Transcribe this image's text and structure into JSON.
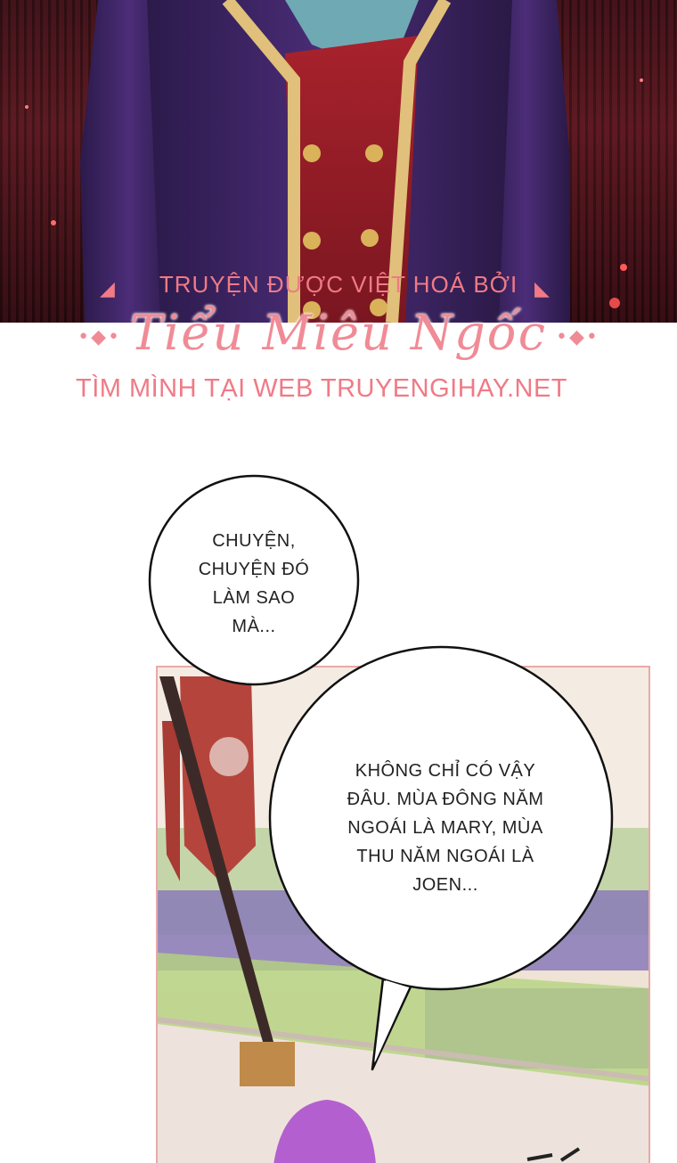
{
  "credits": {
    "line1": "TRUYỆN ĐƯỢC VIỆT HOÁ BỞI",
    "group_name": "Tiểu Miêu Ngốc",
    "line3": "TÌM MÌNH TẠI WEB TRUYENGIHAY.NET",
    "accent_color": "#f07a86"
  },
  "bubbles": [
    {
      "text": "CHUYỆN,\nCHUYỆN ĐÓ\nLÀM SAO\nMÀ..."
    },
    {
      "text": "KHÔNG CHỈ CÓ VẬY\nĐÂU. MÙA ĐÔNG NĂM\nNGOÁI LÀ MARY, MÙA\nTHU NĂM NGOÁI LÀ\nJOEN..."
    }
  ],
  "icons": {
    "deco_left": "ornament-left-icon",
    "deco_right": "ornament-right-icon"
  }
}
